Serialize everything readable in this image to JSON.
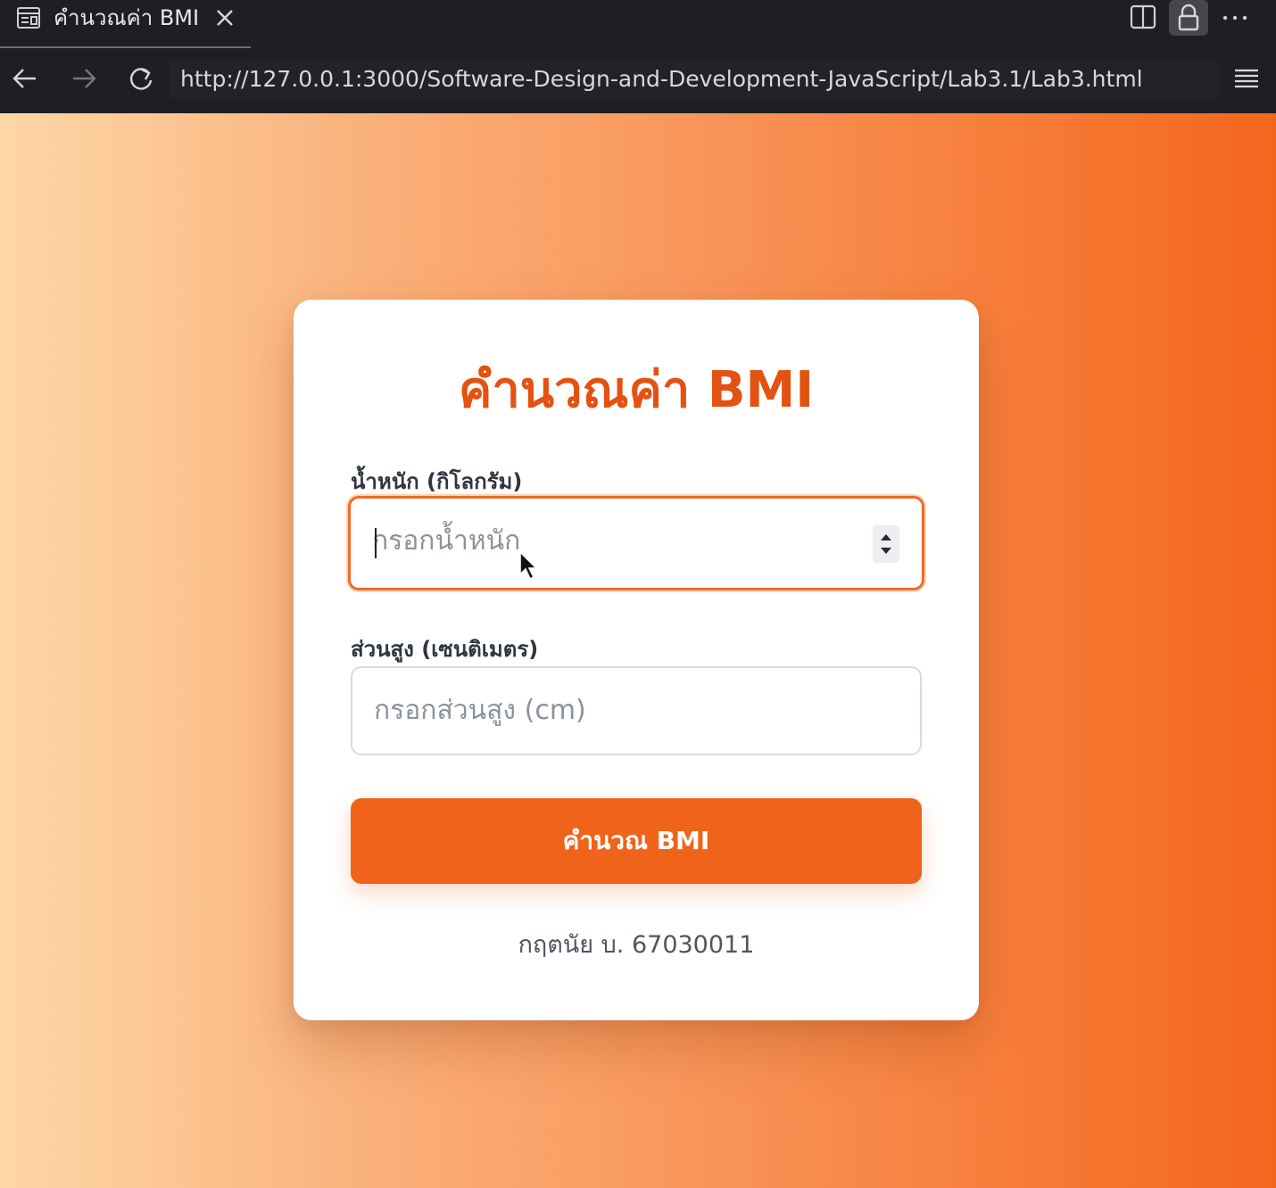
{
  "browser": {
    "tab_title": "คำนวณค่า BMI",
    "url": "http://127.0.0.1:3000/Software-Design-and-Development-JavaScript/Lab3.1/Lab3.html",
    "icons": [
      "tab-page-icon",
      "close-icon",
      "split-view-icon",
      "lock-icon",
      "more-icon",
      "back-icon",
      "forward-icon",
      "reload-icon",
      "menu-icon"
    ]
  },
  "page": {
    "title": "คำนวณค่า BMI",
    "weight": {
      "label": "น้ำหนัก (กิโลกรัม)",
      "placeholder": "กรอกน้ำหนัก",
      "value": ""
    },
    "height": {
      "label": "ส่วนสูง (เซนติเมตร)",
      "placeholder": "กรอกส่วนสูง (cm)",
      "value": ""
    },
    "button_label": "คำนวณ BMI",
    "footer": "กฤตนัย บ. 67030011"
  },
  "colors": {
    "accent": "#f0631a",
    "title": "#e35211",
    "gradient_start": "#fdd7a6",
    "gradient_end": "#f3661d"
  }
}
